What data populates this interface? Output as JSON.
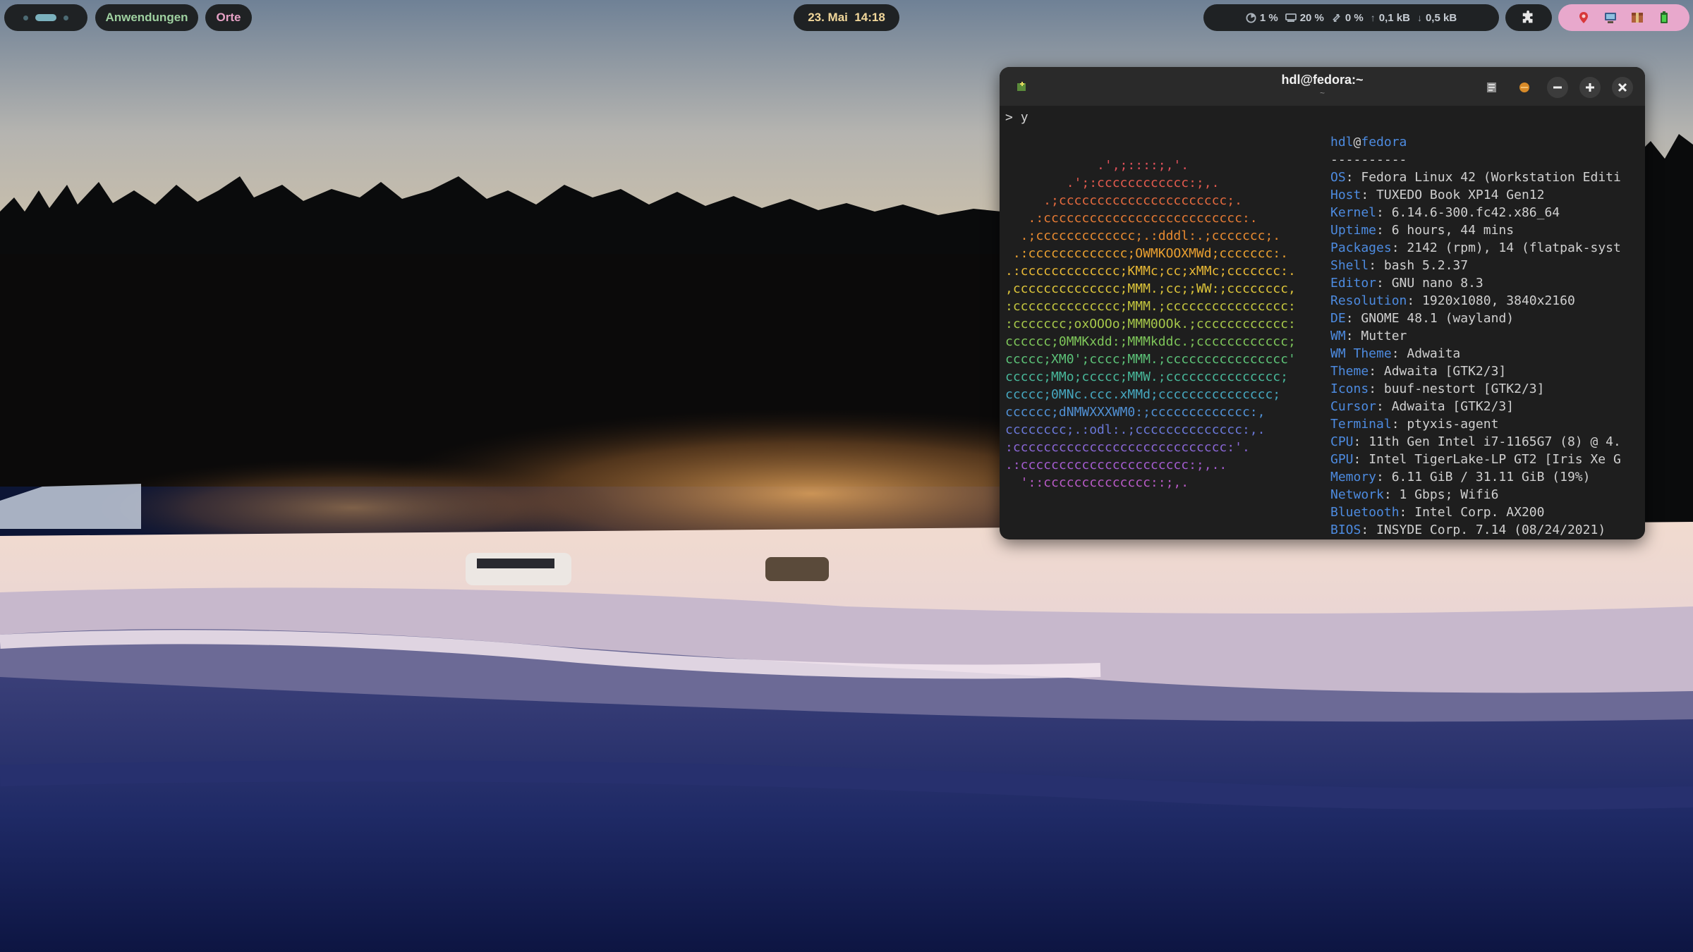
{
  "topbar": {
    "apps_label": "Anwendungen",
    "places_label": "Orte",
    "clock": "23. Mai  14:18",
    "stats": {
      "cpu": "1 %",
      "ram": "20 %",
      "swap": "0 %",
      "upload": "0,1 kB",
      "download": "0,5 kB"
    },
    "tray_icons": [
      "pin-icon",
      "network-icon",
      "package-icon",
      "battery-icon"
    ]
  },
  "terminal": {
    "title": "hdl@fedora:~",
    "subtitle": "~",
    "prompt": ">",
    "command": "y",
    "logo_lines": [
      {
        "text": "            .',;::::;,'.",
        "color": "#e0505a"
      },
      {
        "text": "        .';:cccccccccccc:;,.",
        "color": "#e25a4e"
      },
      {
        "text": "     .;cccccccccccccccccccccc;.",
        "color": "#e56a3e"
      },
      {
        "text": "   .:cccccccccccccccccccccccccc:.",
        "color": "#e57a34"
      },
      {
        "text": "  .;ccccccccccccc;.:dddl:.;ccccccc;.",
        "color": "#e88a30"
      },
      {
        "text": " .:ccccccccccccc;OWMKOOXMWd;ccccccc:.",
        "color": "#eaa030"
      },
      {
        "text": ".:ccccccccccccc;KMMc;cc;xMMc;ccccccc:.",
        "color": "#e8b835"
      },
      {
        "text": ",cccccccccccccc;MMM.;cc;;WW:;cccccccc,",
        "color": "#dcc43a"
      },
      {
        "text": ":cccccccccccccc;MMM.;cccccccccccccccc:",
        "color": "#c4c63e"
      },
      {
        "text": ":ccccccc;oxOOOo;MMM0OOk.;cccccccccccc:",
        "color": "#a6c84a"
      },
      {
        "text": "cccccc;0MMKxdd:;MMMkddc.;cccccccccccc;",
        "color": "#7ec65a"
      },
      {
        "text": "ccccc;XM0';cccc;MMM.;cccccccccccccccc'",
        "color": "#5cc278"
      },
      {
        "text": "ccccc;MMo;ccccc;MMW.;ccccccccccccccc;",
        "color": "#48b89a"
      },
      {
        "text": "ccccc;0MNc.ccc.xMMd;ccccccccccccccc;",
        "color": "#46a8c0"
      },
      {
        "text": "cccccc;dNMWXXXWM0:;ccccccccccccc:,",
        "color": "#5090d4"
      },
      {
        "text": "cccccccc;.:odl:.;cccccccccccccc:,.",
        "color": "#6a78d8"
      },
      {
        "text": ":cccccccccccccccccccccccccccc:'.",
        "color": "#8a66d6"
      },
      {
        "text": ".:cccccccccccccccccccccc:;,..",
        "color": "#a45cd0"
      },
      {
        "text": "  '::cccccccccccccc::;,.",
        "color": "#b85ac6"
      }
    ],
    "info": {
      "user": "hdl",
      "host": "fedora",
      "separator": "----------",
      "rows": [
        {
          "key": "OS",
          "value": "Fedora Linux 42 (Workstation Editi"
        },
        {
          "key": "Host",
          "value": "TUXEDO Book XP14 Gen12"
        },
        {
          "key": "Kernel",
          "value": "6.14.6-300.fc42.x86_64"
        },
        {
          "key": "Uptime",
          "value": "6 hours, 44 mins"
        },
        {
          "key": "Packages",
          "value": "2142 (rpm), 14 (flatpak-syst"
        },
        {
          "key": "Shell",
          "value": "bash 5.2.37"
        },
        {
          "key": "Editor",
          "value": "GNU nano 8.3"
        },
        {
          "key": "Resolution",
          "value": "1920x1080, 3840x2160"
        },
        {
          "key": "DE",
          "value": "GNOME 48.1 (wayland)"
        },
        {
          "key": "WM",
          "value": "Mutter"
        },
        {
          "key": "WM Theme",
          "value": "Adwaita"
        },
        {
          "key": "Theme",
          "value": "Adwaita [GTK2/3]"
        },
        {
          "key": "Icons",
          "value": "buuf-nestort [GTK2/3]"
        },
        {
          "key": "Cursor",
          "value": "Adwaita [GTK2/3]"
        },
        {
          "key": "Terminal",
          "value": "ptyxis-agent"
        },
        {
          "key": "CPU",
          "value": "11th Gen Intel i7-1165G7 (8) @ 4."
        },
        {
          "key": "GPU",
          "value": "Intel TigerLake-LP GT2 [Iris Xe G"
        },
        {
          "key": "Memory",
          "value": "6.11 GiB / 31.11 GiB (19%)"
        },
        {
          "key": "Network",
          "value": "1 Gbps; Wifi6"
        },
        {
          "key": "Bluetooth",
          "value": "Intel Corp. AX200"
        },
        {
          "key": "BIOS",
          "value": "INSYDE Corp. 7.14 (08/24/2021)"
        }
      ]
    }
  }
}
